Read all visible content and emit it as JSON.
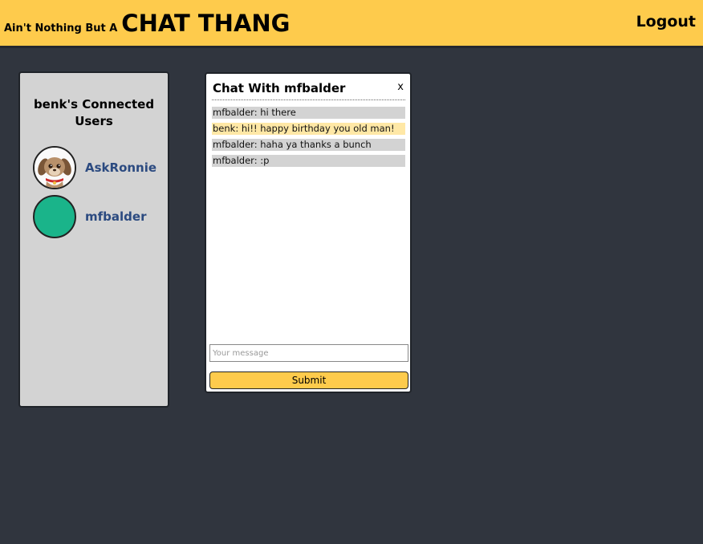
{
  "header": {
    "brand_prefix": "Ain't Nothing But A",
    "brand_main": "CHAT THANG",
    "logout_label": "Logout"
  },
  "sidebar": {
    "title": "benk's Connected Users",
    "users": [
      {
        "name": "AskRonnie",
        "avatar": "puppy-avatar"
      },
      {
        "name": "mfbalder",
        "avatar": "teal-circle-avatar"
      }
    ]
  },
  "chat": {
    "title": "Chat With mfbalder",
    "close_label": "x",
    "messages": [
      {
        "text": "mfbalder: hi there",
        "from_self": false
      },
      {
        "text": "benk: hi!! happy birthday you old man!",
        "from_self": true
      },
      {
        "text": "mfbalder: haha ya thanks a bunch",
        "from_self": false
      },
      {
        "text": "mfbalder: :p",
        "from_self": false
      }
    ],
    "input_placeholder": "Your message",
    "input_value": "",
    "submit_label": "Submit"
  },
  "colors": {
    "accent": "#fecb4c",
    "background": "#30353e",
    "panel": "#d3d3d3",
    "self_message": "#ffe8a6",
    "user_link": "#2b4a80",
    "teal_avatar": "#1ab48a"
  }
}
